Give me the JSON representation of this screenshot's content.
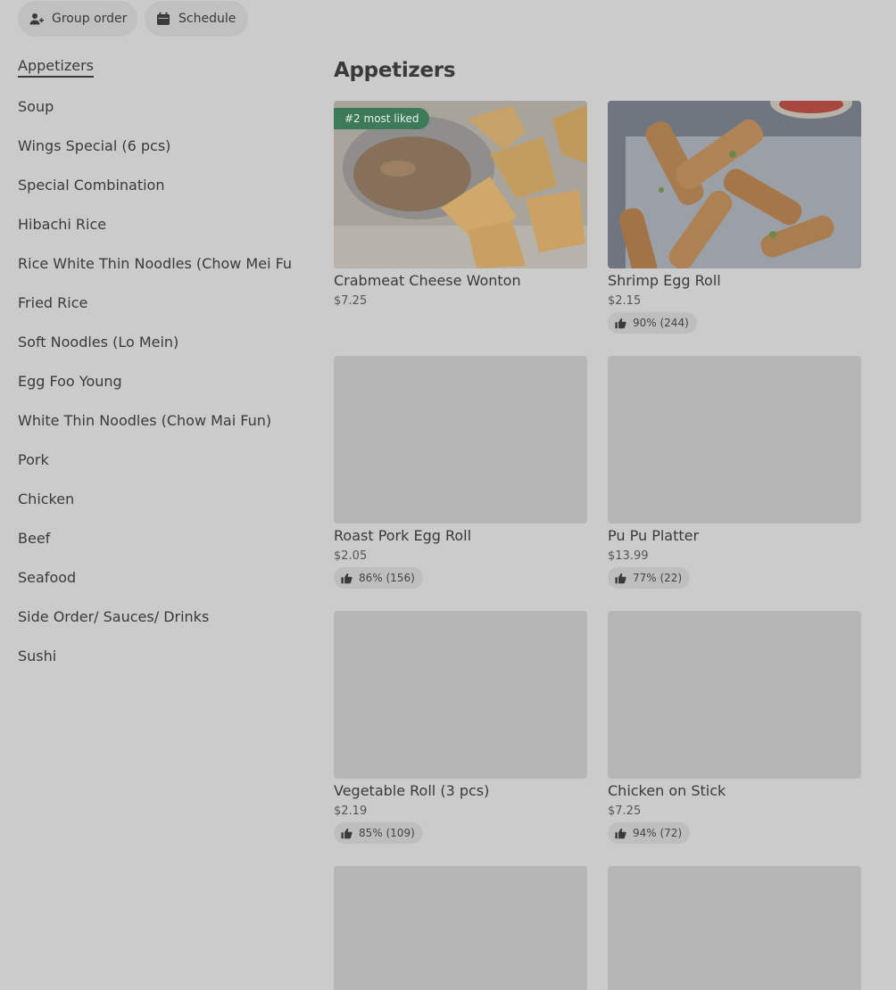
{
  "top_actions": {
    "group_order_label": "Group order",
    "schedule_label": "Schedule"
  },
  "sidebar": {
    "items": [
      {
        "label": "Appetizers",
        "active": true
      },
      {
        "label": "Soup"
      },
      {
        "label": "Wings Special (6 pcs)"
      },
      {
        "label": "Special Combination"
      },
      {
        "label": "Hibachi Rice"
      },
      {
        "label": "Rice White Thin Noodles (Chow Mei Fun)"
      },
      {
        "label": "Fried Rice"
      },
      {
        "label": "Soft Noodles (Lo Mein)"
      },
      {
        "label": "Egg Foo Young"
      },
      {
        "label": "White Thin Noodles (Chow Mai Fun)"
      },
      {
        "label": "Pork"
      },
      {
        "label": "Chicken"
      },
      {
        "label": "Beef"
      },
      {
        "label": "Seafood"
      },
      {
        "label": "Side Order/ Sauces/ Drinks"
      },
      {
        "label": "Sushi"
      }
    ]
  },
  "section": {
    "title": "Appetizers",
    "items": [
      {
        "name": "Crabmeat Cheese Wonton",
        "price": "$7.25",
        "badge": "#2 most liked"
      },
      {
        "name": "Shrimp Egg Roll",
        "price": "$2.15",
        "rating": "90% (244)"
      },
      {
        "name": "Roast Pork Egg Roll",
        "price": "$2.05",
        "rating": "86% (156)"
      },
      {
        "name": "Pu Pu Platter",
        "price": "$13.99",
        "rating": "77% (22)"
      },
      {
        "name": "Vegetable Roll (3 pcs)",
        "price": "$2.19",
        "rating": "85% (109)"
      },
      {
        "name": "Chicken on Stick",
        "price": "$7.25",
        "rating": "94% (72)"
      }
    ]
  },
  "colors": {
    "page_background": "#cbcbcb",
    "badge_green": "#3d7a5a",
    "placeholder": "#b6b6b6"
  }
}
